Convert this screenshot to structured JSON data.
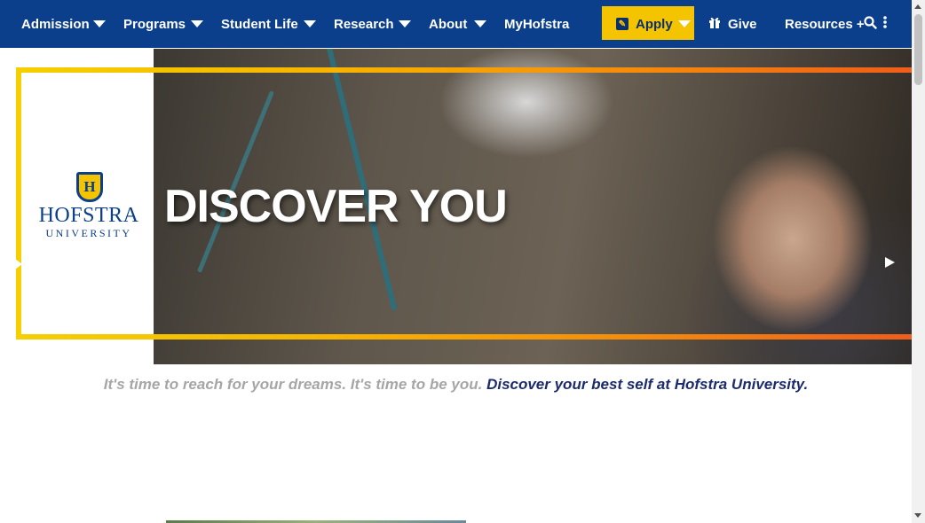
{
  "nav": {
    "items": [
      {
        "label": "Admission",
        "has_dropdown": true
      },
      {
        "label": "Programs",
        "has_dropdown": true
      },
      {
        "label": "Student Life",
        "has_dropdown": true
      },
      {
        "label": "Research",
        "has_dropdown": true
      },
      {
        "label": "About",
        "has_dropdown": true
      },
      {
        "label": "MyHofstra",
        "has_dropdown": false
      }
    ],
    "apply_label": "Apply",
    "apply_icon": "edit-icon",
    "give_label": "Give",
    "give_icon": "gift-icon",
    "resources_label": "Resources +",
    "search_icon": "search-icon",
    "more_icon": "vertical-ellipsis-icon"
  },
  "hero": {
    "headline": "DISCOVER YOU",
    "logo": {
      "name": "HOFSTRA",
      "subname": "UNIVERSITY",
      "shield_letter": "H"
    },
    "next_icon": "play-right-icon"
  },
  "tagline": {
    "lead": "It's time to reach for your dreams. It's time to be you. ",
    "link": "Discover your best self at Hofstra University."
  },
  "colors": {
    "nav_bg": "#0b3f8c",
    "apply_bg": "#f5c400",
    "frame_start": "#f5cf00",
    "frame_end": "#ef5d1a",
    "link": "#1c2b6e",
    "tagline_grey": "#a6a6a6"
  }
}
